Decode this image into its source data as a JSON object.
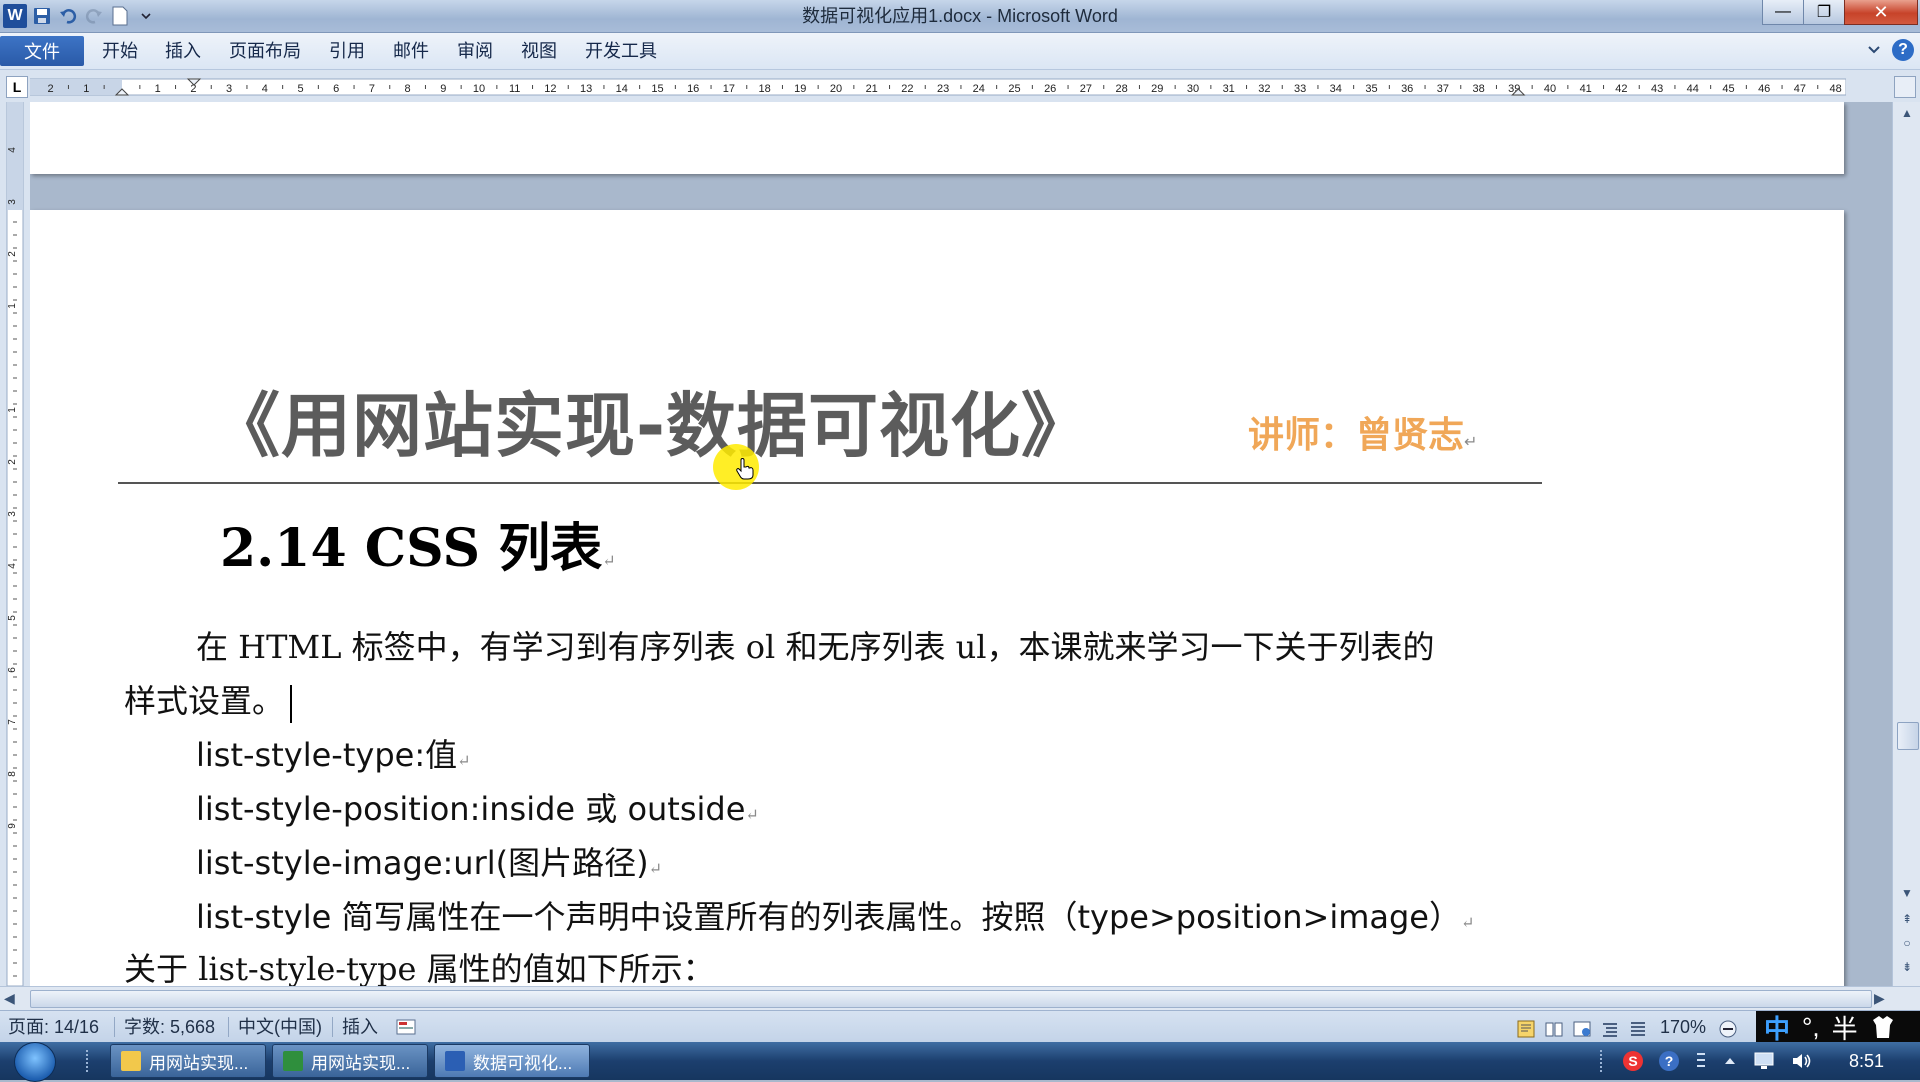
{
  "window": {
    "title": "数据可视化应用1.docx - Microsoft Word",
    "minimize_label": "—",
    "maximize_label": "❐",
    "close_label": "✕"
  },
  "qat": {
    "logo": "W",
    "save_icon": "save-icon",
    "undo_icon": "undo-icon",
    "redo_icon": "redo-icon",
    "new_icon": "new-document-icon",
    "customize_icon": "chevron-down-icon"
  },
  "ribbon": {
    "file_tab": "文件",
    "tabs": [
      "开始",
      "插入",
      "页面布局",
      "引用",
      "邮件",
      "审阅",
      "视图",
      "开发工具"
    ],
    "help_label": "?"
  },
  "ruler": {
    "tab_selector": "L",
    "left_numbers": [
      "2",
      "1"
    ],
    "right_numbers": [
      "1",
      "2",
      "3",
      "4",
      "5",
      "6",
      "7",
      "8",
      "9",
      "10",
      "11",
      "12",
      "13",
      "14",
      "15",
      "16",
      "17",
      "18",
      "19",
      "20",
      "21",
      "22",
      "23",
      "24",
      "25",
      "26",
      "27",
      "28",
      "29",
      "30",
      "31",
      "32",
      "33",
      "34",
      "35",
      "36",
      "37",
      "38",
      "39",
      "40",
      "41",
      "42",
      "43",
      "44",
      "45",
      "46",
      "47",
      "48"
    ],
    "v_numbers": [
      "4",
      "3",
      "2",
      "1",
      "1",
      "2",
      "3",
      "4",
      "5",
      "6",
      "7",
      "8",
      "9"
    ]
  },
  "document": {
    "header_title": "《用网站实现-数据可视化》",
    "header_author": "讲师：曾贤志",
    "heading": "2.14 CSS 列表",
    "paragraph_mark": "↵",
    "intro_line1": "在 HTML 标签中，有学习到有序列表 ol 和无序列表 ul，本课就来学习一下关于列表的",
    "intro_line2": "样式设置。",
    "props": [
      "list-style-type:值",
      "list-style-position:inside 或 outside",
      "list-style-image:url(图片路径)",
      "list-style  简写属性在一个声明中设置所有的列表属性。按照（type>position>image）"
    ],
    "last_line": "关于 list-style-type 属性的值如下所示："
  },
  "status": {
    "page": "页面: 14/16",
    "words": "字数: 5,668",
    "language": "中文(中国)",
    "mode": "插入",
    "zoom": "170%"
  },
  "ime": {
    "mode": "中",
    "punct": "°,",
    "width": "半"
  },
  "taskbar": {
    "buttons": [
      {
        "label": "用网站实现...",
        "icon_color": "#f2c84b"
      },
      {
        "label": "用网站实现...",
        "icon_color": "#2f8f3d"
      },
      {
        "label": "数据可视化...",
        "icon_color": "#2b5fb4"
      }
    ],
    "clock": "8:51"
  },
  "colors": {
    "author": "#f0a758",
    "header_title": "#5c5c5c",
    "cursor_highlight": "#ffeb00"
  }
}
